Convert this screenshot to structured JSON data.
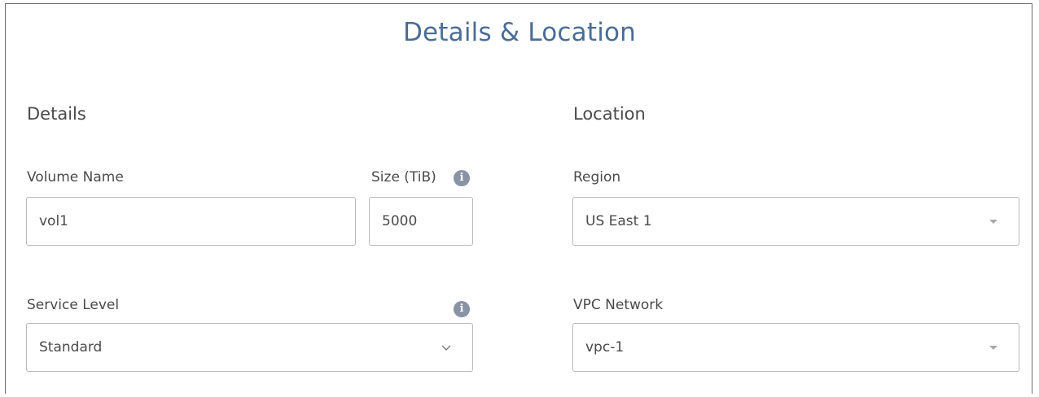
{
  "title": "Details & Location",
  "details": {
    "heading": "Details",
    "volume_name": {
      "label": "Volume Name",
      "value": "vol1"
    },
    "size": {
      "label": "Size (TiB)",
      "value": "5000",
      "info_icon": "info-icon"
    },
    "service_level": {
      "label": "Service Level",
      "selected": "Standard",
      "info_icon": "info-icon",
      "dropdown_icon": "chevron-down-icon"
    }
  },
  "location": {
    "heading": "Location",
    "region": {
      "label": "Region",
      "selected": "US East 1",
      "dropdown_icon": "caret-down-icon"
    },
    "vpc_network": {
      "label": "VPC Network",
      "selected": "vpc-1",
      "dropdown_icon": "caret-down-icon"
    }
  },
  "colors": {
    "title": "#4a6d96",
    "text": "#4a4a4a",
    "input_border": "#b9b9b9",
    "info_icon": "#8a93a6",
    "panel_border": "#6b6b6b"
  }
}
